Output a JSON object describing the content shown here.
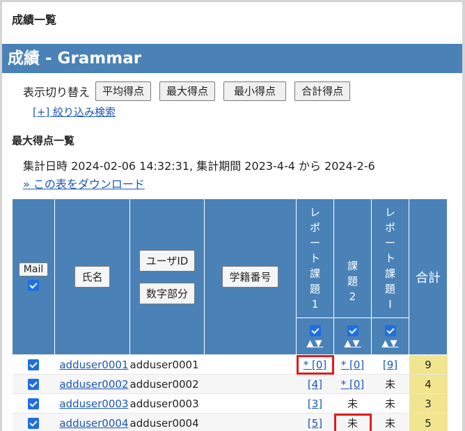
{
  "breadcrumb": "成績一覧",
  "page_title": "成績 - Grammar",
  "display_toggle": {
    "label": "表示切り替え",
    "buttons": [
      "平均得点",
      "最大得点",
      "最小得点",
      "合計得点"
    ]
  },
  "filter_link": "[+] 絞り込み検索",
  "section_title": "最大得点一覧",
  "summary": "集計日時 2024-02-06 14:32:31, 集計期間 2023-4-4 から 2024-2-6",
  "download_link": "» この表をダウンロード",
  "table": {
    "headers": {
      "mail": "Mail",
      "name": "氏名",
      "userid": "ユーザID",
      "number_part": "数字部分",
      "student_no": "学籍番号",
      "col1": [
        "レ",
        "ポ",
        "ー",
        "ト",
        "課",
        "題",
        "1"
      ],
      "col2": [
        "課",
        "題",
        "2"
      ],
      "col3": [
        "レ",
        "ポ",
        "ー",
        "ト",
        "課",
        "題",
        "I"
      ],
      "total": "合計",
      "sort": "▲▼"
    },
    "rows": [
      {
        "userid": "adduser0001",
        "name": "adduser0001",
        "c1": "* [0]",
        "c2": "* [0]",
        "c3": "[9]",
        "total": "9"
      },
      {
        "userid": "adduser0002",
        "name": "adduser0002",
        "c1": "[4]",
        "c2": "* [0]",
        "c3": "未",
        "total": "4"
      },
      {
        "userid": "adduser0003",
        "name": "adduser0003",
        "c1": "[3]",
        "c2": "未",
        "c3": "未",
        "total": "3"
      },
      {
        "userid": "adduser0004",
        "name": "adduser0004",
        "c1": "[5]",
        "c2": "未",
        "c3": "未",
        "total": "5"
      }
    ]
  }
}
